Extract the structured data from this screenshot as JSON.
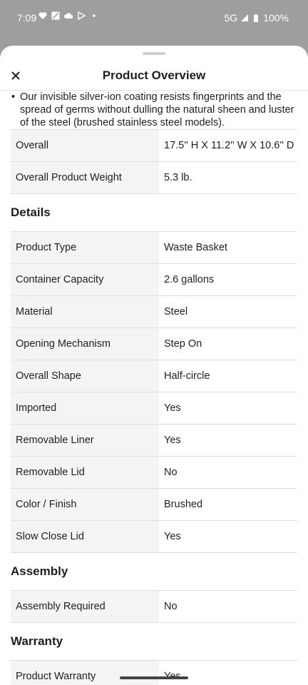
{
  "status": {
    "time": "7:09",
    "network": "5G",
    "battery": "100%"
  },
  "sheet": {
    "title": "Product Overview",
    "bullet_text": "Our invisible silver-ion coating resists fingerprints and the spread of germs without dulling the natural sheen and luster of the steel (brushed stainless steel models)."
  },
  "dimensions": [
    {
      "label": "Overall",
      "value": "17.5'' H X 11.2'' W X 10.6'' D"
    },
    {
      "label": "Overall Product Weight",
      "value": "5.3 lb."
    }
  ],
  "details": {
    "title": "Details",
    "rows": [
      {
        "label": "Product Type",
        "value": "Waste Basket"
      },
      {
        "label": "Container Capacity",
        "value": "2.6 gallons"
      },
      {
        "label": "Material",
        "value": "Steel"
      },
      {
        "label": "Opening Mechanism",
        "value": "Step On"
      },
      {
        "label": "Overall Shape",
        "value": "Half-circle"
      },
      {
        "label": "Imported",
        "value": "Yes"
      },
      {
        "label": "Removable Liner",
        "value": "Yes"
      },
      {
        "label": "Removable Lid",
        "value": "No"
      },
      {
        "label": "Color / Finish",
        "value": "Brushed"
      },
      {
        "label": "Slow Close Lid",
        "value": "Yes"
      }
    ]
  },
  "assembly": {
    "title": "Assembly",
    "rows": [
      {
        "label": "Assembly Required",
        "value": "No"
      }
    ]
  },
  "warranty": {
    "title": "Warranty",
    "rows": [
      {
        "label": "Product Warranty",
        "value": "Yes"
      }
    ]
  }
}
